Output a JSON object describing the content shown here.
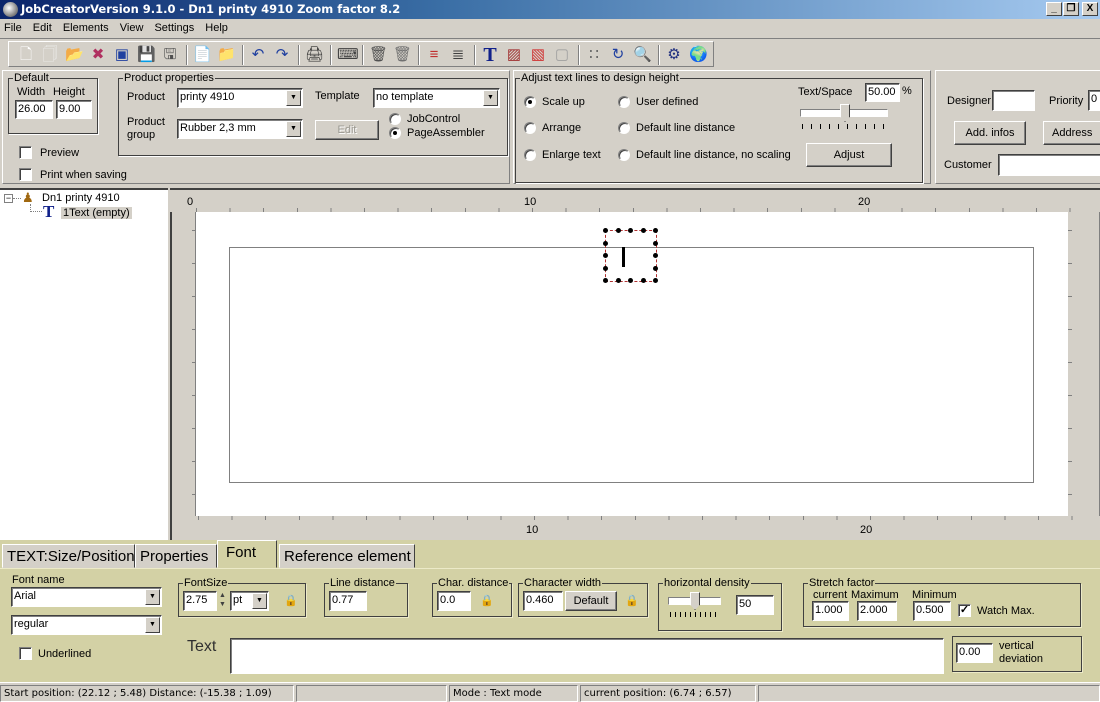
{
  "window": {
    "title": "JobCreatorVersion 9.1.0 -  Dn1 printy 4910 Zoom factor 8.2",
    "controls": {
      "minimize": "_",
      "restore": "❐",
      "close": "X"
    }
  },
  "menu": [
    "File",
    "Edit",
    "Elements",
    "View",
    "Settings",
    "Help"
  ],
  "toolbar": {
    "icons": [
      {
        "name": "new-document-icon",
        "glyph": "🗋"
      },
      {
        "name": "new-copy-icon",
        "glyph": "🗍"
      },
      {
        "name": "open-folder-icon",
        "glyph": "📂"
      },
      {
        "name": "close-layout-icon",
        "glyph": "✖"
      },
      {
        "name": "layout-icon",
        "glyph": "▣"
      },
      {
        "name": "save-icon",
        "glyph": "💾"
      },
      {
        "name": "save-as-icon",
        "glyph": "🖫"
      },
      {
        "name": "import-icon",
        "glyph": "📄"
      },
      {
        "name": "export-icon",
        "glyph": "📁"
      },
      {
        "name": "undo-icon",
        "glyph": "↶"
      },
      {
        "name": "redo-icon",
        "glyph": "↷"
      },
      {
        "name": "print-icon",
        "glyph": "🖨"
      },
      {
        "name": "keyboard-icon",
        "glyph": "⌨"
      },
      {
        "name": "delete-icon",
        "glyph": "🗑"
      },
      {
        "name": "delete-all-icon",
        "glyph": "🗑"
      },
      {
        "name": "sort-lines-icon",
        "glyph": "≡"
      },
      {
        "name": "sort-lines-down-icon",
        "glyph": "≣"
      },
      {
        "name": "text-tool-icon",
        "glyph": "T"
      },
      {
        "name": "graphic-tool-icon",
        "glyph": "▨"
      },
      {
        "name": "shape-tool-icon",
        "glyph": "▧"
      },
      {
        "name": "shape-disabled-icon",
        "glyph": "▢"
      },
      {
        "name": "grid-icon",
        "glyph": "∷"
      },
      {
        "name": "refresh-icon",
        "glyph": "↻"
      },
      {
        "name": "zoom-icon",
        "glyph": "🔍"
      },
      {
        "name": "settings-gear-icon",
        "glyph": "⚙"
      },
      {
        "name": "globe-icon",
        "glyph": "🌍"
      }
    ]
  },
  "default_group": {
    "label": "Default",
    "width_label": "Width",
    "height_label": "Height",
    "width_value": "26.00",
    "height_value": "9.00",
    "preview_label": "Preview",
    "preview_checked": false,
    "print_when_saving_label": "Print when saving",
    "print_when_saving_checked": false
  },
  "product_properties": {
    "label": "Product properties",
    "product_label": "Product",
    "product_value": "printy 4910",
    "product_group_label_1": "Product",
    "product_group_label_2": "group",
    "product_group_value": "Rubber 2,3 mm",
    "template_label": "Template",
    "template_value": "no template",
    "edit_button": "Edit",
    "radio_jobcontrol": "JobControl",
    "radio_pageassembler": "PageAssembler",
    "selected_mode": "PageAssembler"
  },
  "adjust_text": {
    "label": "Adjust text lines to design height",
    "options": [
      "Scale up",
      "User defined",
      "Arrange",
      "Default line distance",
      "Enlarge text",
      "Default line distance, no scaling"
    ],
    "selected": "Scale up",
    "text_space_label": "Text/Space",
    "text_space_value": "50.00",
    "text_space_unit": "%",
    "slider_value_percent": 50,
    "adjust_button": "Adjust"
  },
  "job_info": {
    "designer_label": "Designer",
    "designer_value": "",
    "priority_label": "Priority",
    "priority_value": "0",
    "add_infos_button": "Add. infos",
    "address_button": "Address",
    "customer_label": "Customer",
    "customer_value": ""
  },
  "tree": {
    "root_label": "Dn1 printy 4910",
    "child_label": "1Text (empty)"
  },
  "ruler": {
    "top_labels": [
      "0",
      "10",
      "20"
    ],
    "bottom_labels": [
      "10",
      "20"
    ]
  },
  "tabs": [
    {
      "label": "TEXT:Size/Position",
      "active": false
    },
    {
      "label": "Properties",
      "active": false
    },
    {
      "label": "Font",
      "active": true
    },
    {
      "label": "Reference element",
      "active": false
    }
  ],
  "font_panel": {
    "font_name_label": "Font name",
    "font_name_value": "Arial",
    "font_style_value": "regular",
    "underlined_label": "Underlined",
    "underlined_checked": false,
    "font_size_label": "FontSize",
    "font_size_value": "2.75",
    "font_size_unit": "pt",
    "line_distance_label": "Line distance",
    "line_distance_value": "0.77",
    "char_distance_label": "Char. distance",
    "char_distance_value": "0.0",
    "char_width_label": "Character width",
    "char_width_value": "0.460",
    "default_button": "Default",
    "horizontal_density_label": "horizontal density",
    "horizontal_density_value": "50",
    "stretch_label": "Stretch factor",
    "stretch_current_label": "current",
    "stretch_max_label": "Maximum",
    "stretch_min_label": "Minimum",
    "stretch_current_value": "1.000",
    "stretch_max_value": "2.000",
    "stretch_min_value": "0.500",
    "watch_max_label": "Watch Max.",
    "watch_max_checked": true,
    "text_label": "Text",
    "text_value": "",
    "vertical_deviation_value": "0.00",
    "vertical_deviation_label_1": "vertical",
    "vertical_deviation_label_2": "deviation"
  },
  "statusbar": {
    "start_distance": "Start position: (22.12 ; 5.48)  Distance: (-15.38 ; 1.09)",
    "mode": "Mode : Text mode",
    "current_position": "current position: (6.74 ; 6.57)"
  }
}
